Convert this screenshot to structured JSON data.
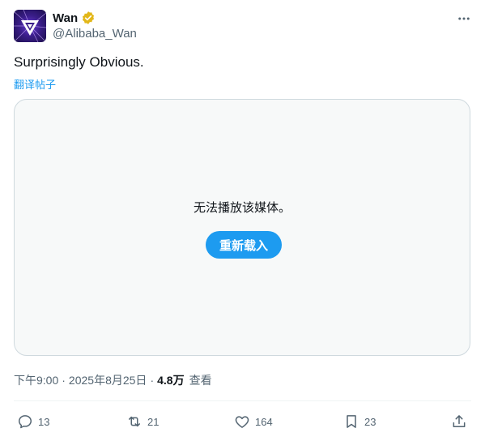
{
  "user": {
    "name": "Wan",
    "handle": "@Alibaba_Wan",
    "verified_color": "#e2b719"
  },
  "tweet": {
    "text": "Surprisingly Obvious.",
    "translate_label": "翻译帖子"
  },
  "media": {
    "error_message": "无法播放该媒体。",
    "reload_label": "重新载入"
  },
  "meta": {
    "time": "下午9:00",
    "date": "2025年8月25日",
    "views_count": "4.8万",
    "views_label": "查看"
  },
  "actions": {
    "replies": "13",
    "reposts": "21",
    "likes": "164",
    "bookmarks": "23"
  },
  "icons": [
    "more-icon",
    "verified-badge-icon",
    "reply-icon",
    "repost-icon",
    "like-icon",
    "bookmark-icon",
    "share-icon"
  ],
  "colors": {
    "accent": "#1d9bf0",
    "secondary_text": "#536471",
    "primary_text": "#0f1419"
  }
}
